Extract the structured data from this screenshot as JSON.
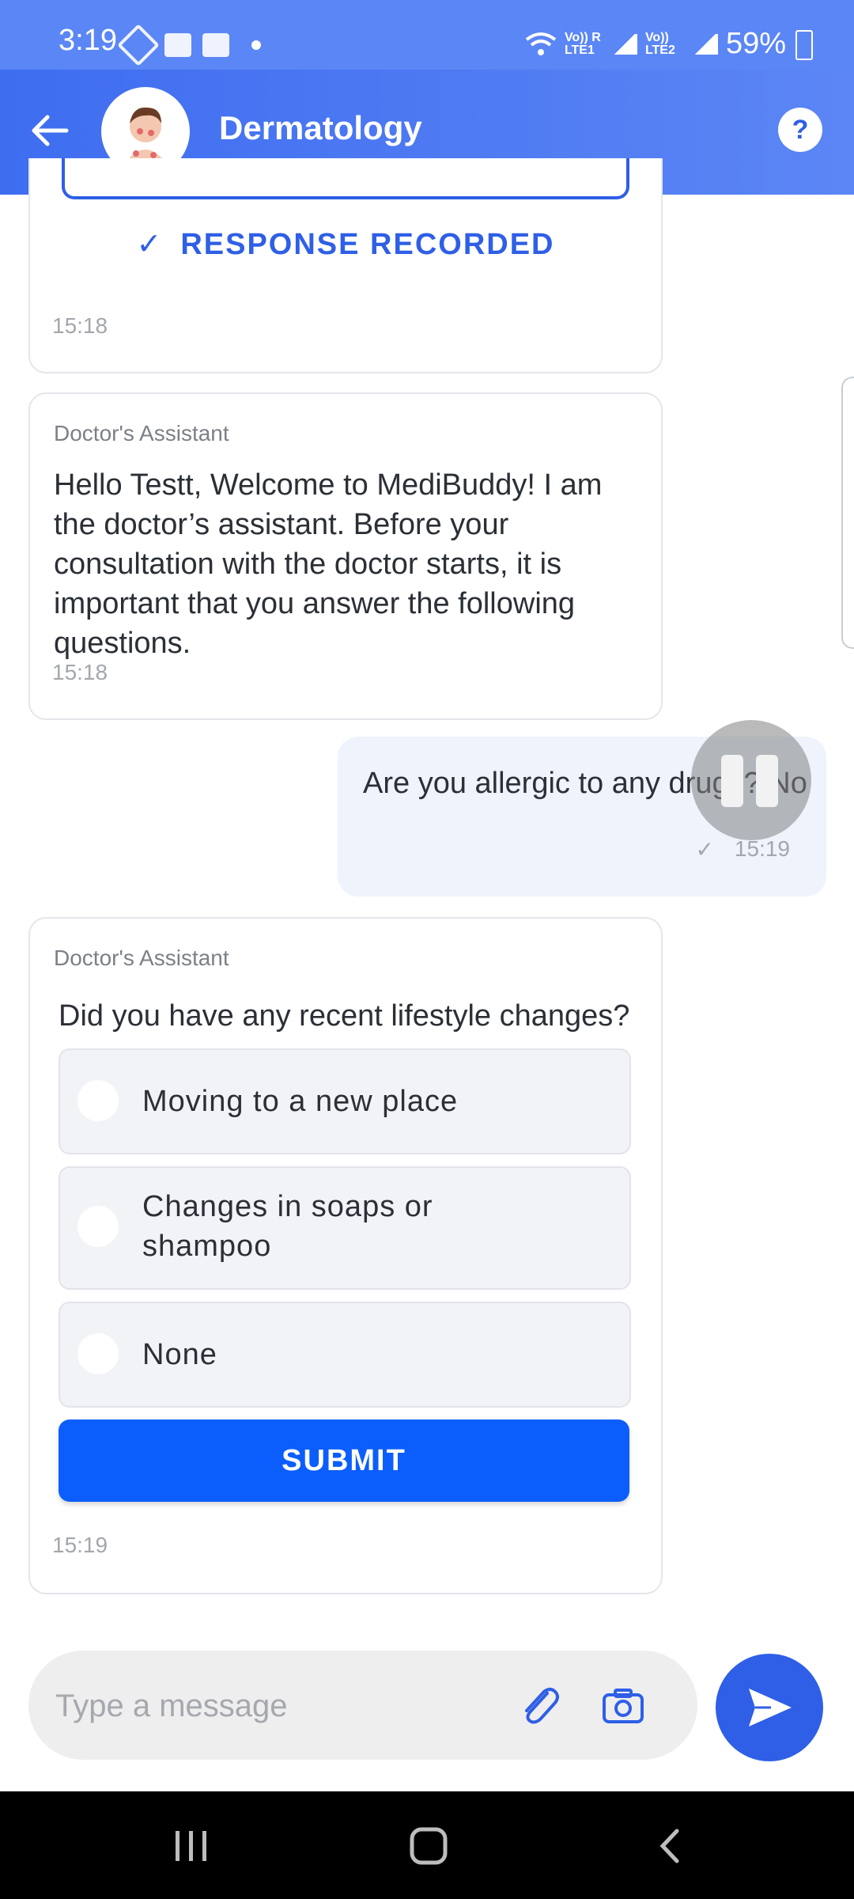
{
  "status_bar": {
    "time": "3:19",
    "network_left": "Vo)) R LTE1",
    "network_right": "Vo)) LTE2",
    "battery": "59%"
  },
  "app_bar": {
    "title": "Dermatology",
    "help": "?",
    "colors": {
      "accent": "#3e6df0",
      "primary_button": "#0c5efc"
    }
  },
  "messages": {
    "response_recorded": {
      "label": "RESPONSE RECORDED",
      "time": "15:18"
    },
    "welcome": {
      "sender": "Doctor's Assistant",
      "text": "Hello Testt, Welcome to MediBuddy! I am the doctor’s assistant. Before your consultation with the doctor starts, it is important that you answer the following questions.",
      "time": "15:18"
    },
    "user_reply": {
      "text": "Are you allergic to any drugs? No",
      "time": "15:19"
    },
    "question": {
      "sender": "Doctor's Assistant",
      "text": "Did you have any recent lifestyle changes?",
      "options": [
        "Moving to a new place",
        "Changes in soaps or shampoo",
        "None"
      ],
      "submit_label": "SUBMIT",
      "time": "15:19"
    }
  },
  "composer": {
    "placeholder": "Type a message",
    "icons": [
      "paperclip-icon",
      "camera-icon",
      "send-icon"
    ]
  },
  "nav_icons": [
    "recent-apps-icon",
    "home-icon",
    "back-icon"
  ]
}
